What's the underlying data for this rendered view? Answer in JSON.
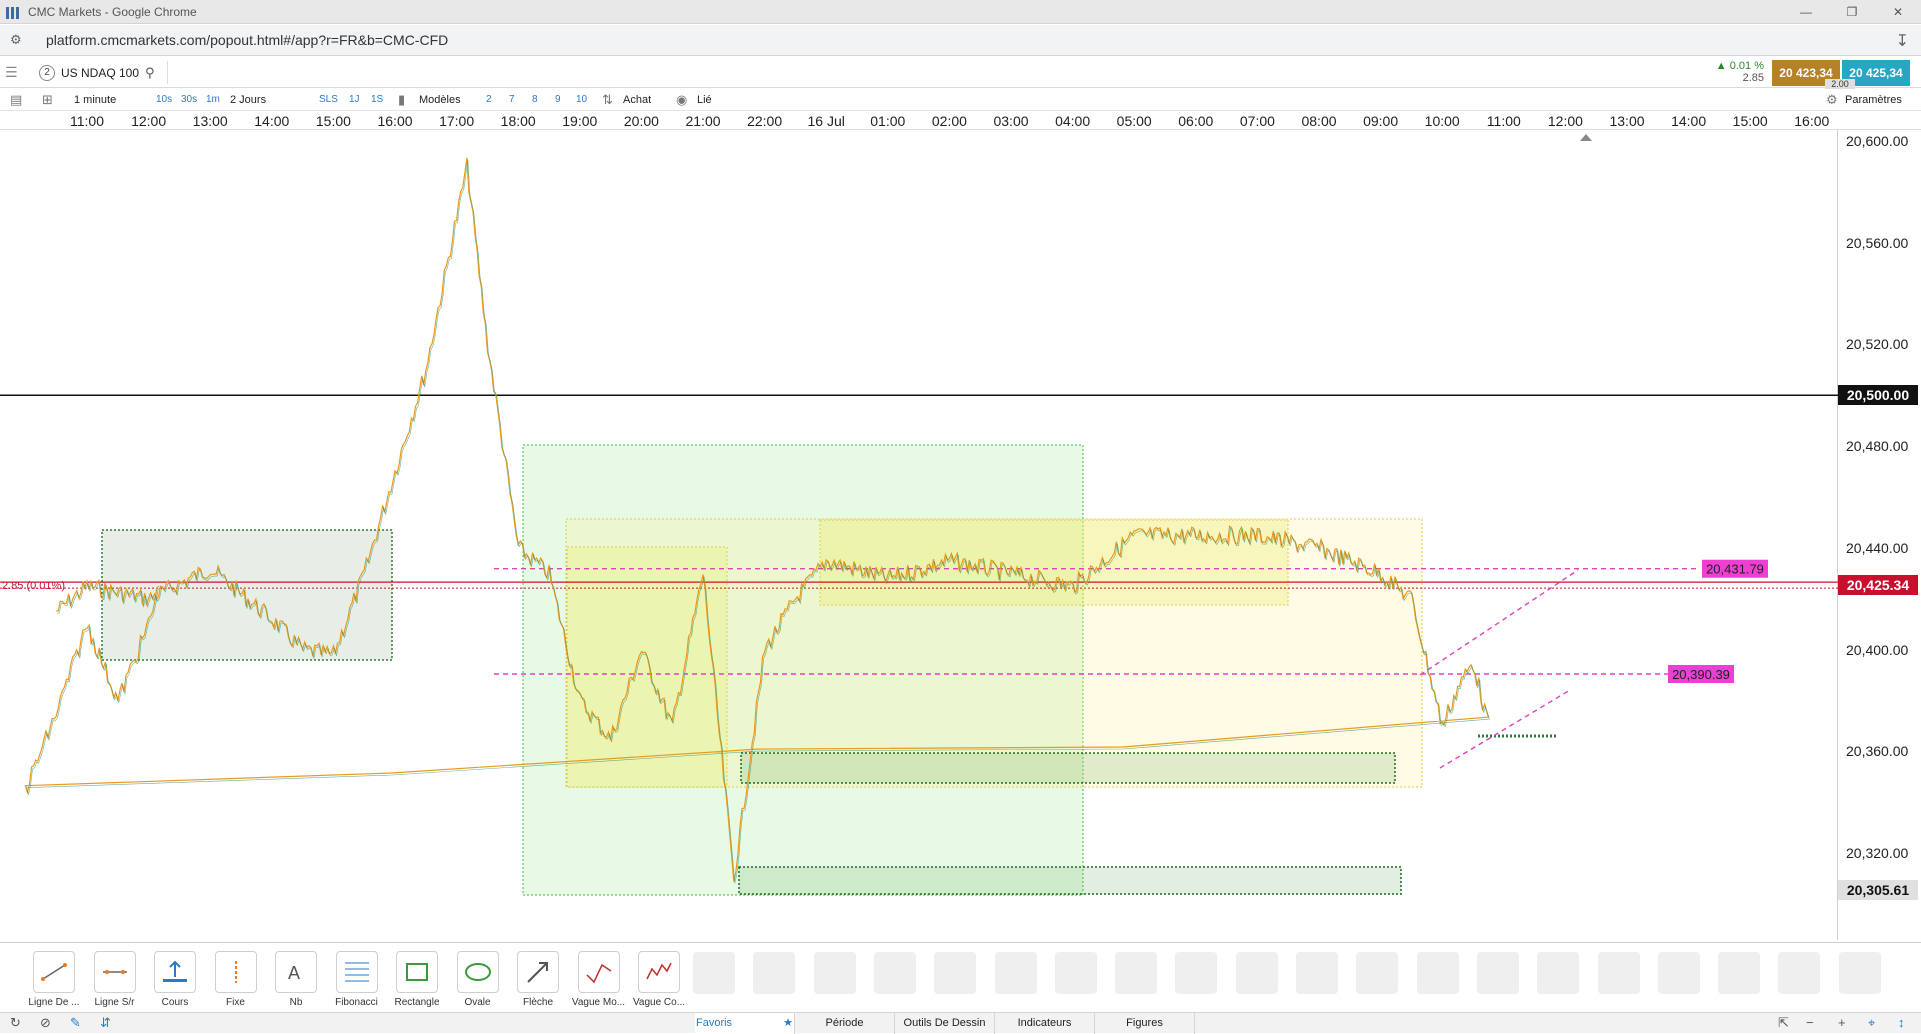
{
  "window": {
    "title": "CMC Markets - Google Chrome"
  },
  "browser": {
    "url": "platform.cmcmarkets.com/popout.html#/app?r=FR&b=CMC-CFD"
  },
  "instrument": {
    "number": "2",
    "name": "US NDAQ 100",
    "change_pct": "0.01 %",
    "change_pts": "2.85",
    "sell_price": "20 423,34",
    "buy_price": "20 425,34",
    "spread": "2.00"
  },
  "toolbar": {
    "interval": "1 minute",
    "quick_intervals": [
      "10s",
      "30s",
      "1m"
    ],
    "period": "2 Jours",
    "quick_buttons": [
      "SLS",
      "1J",
      "1S"
    ],
    "templates_label": "Modèles",
    "numbers": [
      "2",
      "7",
      "8",
      "9",
      "10"
    ],
    "buy_label": "Achat",
    "link_label": "Lié",
    "settings_label": "Paramètres"
  },
  "time_axis": [
    "11:00",
    "12:00",
    "13:00",
    "14:00",
    "15:00",
    "16:00",
    "17:00",
    "18:00",
    "19:00",
    "20:00",
    "21:00",
    "22:00",
    "16 Jul",
    "01:00",
    "02:00",
    "03:00",
    "04:00",
    "05:00",
    "06:00",
    "07:00",
    "08:00",
    "09:00",
    "10:00",
    "11:00",
    "12:00",
    "13:00",
    "14:00",
    "15:00",
    "16:00"
  ],
  "price_axis": [
    "20,600.00",
    "20,560.00",
    "20,520.00",
    "20,480.00",
    "20,440.00",
    "20,400.00",
    "20,360.00",
    "20,320.00"
  ],
  "price_tags": {
    "horizontal_line": "20,500.00",
    "current": "20,425.34",
    "low_marker": "20,305.61",
    "dashed_upper": "20,431.79",
    "dashed_lower": "20,390.39",
    "left_overlay": "2.85 (0.01%)"
  },
  "chart_data": {
    "type": "line",
    "series": [
      {
        "name": "",
        "color": "#e89a1c",
        "x": [
          "10:30",
          "11:00",
          "12:00",
          "13:00",
          "14:00",
          "14:30",
          "15:00",
          "15:30",
          "16:00",
          "16:30",
          "17:00",
          "17:10",
          "17:30",
          "18:00",
          "18:30",
          "19:00",
          "19:30",
          "20:00",
          "20:30",
          "21:00",
          "21:30",
          "22:00",
          "22:30",
          "23:00",
          "16 Jul 00:00",
          "01:00",
          "02:00",
          "03:00",
          "04:00",
          "05:00",
          "06:00",
          "07:00",
          "08:00",
          "08:30",
          "09:00",
          "09:15",
          "09:30",
          "09:45",
          "10:00",
          "10:30",
          "11:00",
          "11:30",
          "12:00",
          "12:10"
        ],
        "y": [
          20415,
          20425,
          20420,
          20432,
          20412,
          20400,
          20398,
          20430,
          20470,
          20510,
          20570,
          20590,
          20520,
          20440,
          20430,
          20380,
          20365,
          20400,
          20370,
          20430,
          20310,
          20400,
          20420,
          20435,
          20428,
          20435,
          20430,
          20425,
          20445,
          20445,
          20445,
          20440,
          20430,
          20420,
          20370,
          20385,
          20395,
          20370,
          20345,
          20375,
          20410,
          20380,
          20410,
          20425
        ]
      }
    ],
    "xlim": [
      "10:30",
      "16:30"
    ],
    "ylim": [
      20290,
      20610
    ],
    "horizontal_lines": [
      20500,
      20431.79,
      20390.39,
      20425.34
    ]
  },
  "drawing_tools": [
    {
      "label": "Ligne De ...",
      "icon": "trend-line-icon"
    },
    {
      "label": "Ligne S/r",
      "icon": "sr-line-icon"
    },
    {
      "label": "Cours",
      "icon": "price-icon"
    },
    {
      "label": "Fixe",
      "icon": "vertical-line-icon"
    },
    {
      "label": "Nb",
      "icon": "text-icon"
    },
    {
      "label": "Fibonacci",
      "icon": "fibonacci-icon"
    },
    {
      "label": "Rectangle",
      "icon": "rectangle-icon"
    },
    {
      "label": "Ovale",
      "icon": "oval-icon"
    },
    {
      "label": "Flèche",
      "icon": "arrow-icon"
    },
    {
      "label": "Vague Mo...",
      "icon": "wave-icon"
    },
    {
      "label": "Vague Co...",
      "icon": "wave-corrective-icon"
    }
  ],
  "bottom_tabs": [
    "Favoris",
    "Période",
    "Outils De Dessin",
    "Indicateurs",
    "Figures"
  ]
}
